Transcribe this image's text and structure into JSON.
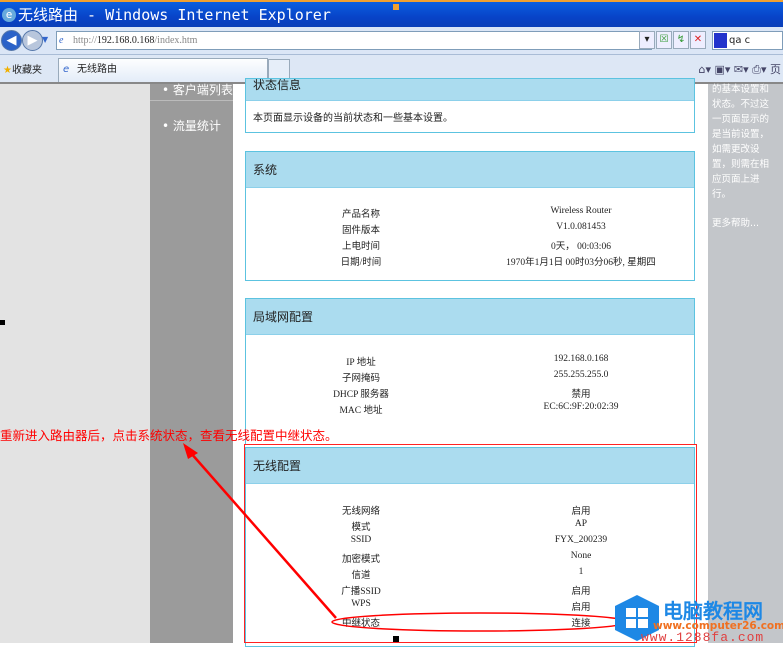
{
  "window": {
    "title": "无线路由 - Windows Internet Explorer"
  },
  "addressbar": {
    "url_prefix": "http://",
    "url_host": "192.168.0.168",
    "url_path": "/index.htm",
    "search_value": "qa c"
  },
  "tabbar": {
    "favorites": "收藏夹",
    "tab_title": "无线路由",
    "page_menu": "页"
  },
  "menu": {
    "items": [
      "客户端列表",
      "流量统计"
    ]
  },
  "help": {
    "text": "的基本设置和状态。不过这一页面显示的是当前设置，如需更改设置，则需在相应页面上进行。",
    "more": "更多帮助..."
  },
  "intro": {
    "header": "状态信息",
    "text": "本页面显示设备的当前状态和一些基本设置。"
  },
  "system": {
    "title": "系统",
    "rows": [
      [
        "产品名称",
        "Wireless Router"
      ],
      [
        "固件版本",
        "V1.0.081453"
      ],
      [
        "上电时间",
        "0天， 00:03:06"
      ],
      [
        "日期/时间",
        "1970年1月1日 00时03分06秒, 星期四"
      ]
    ]
  },
  "lan": {
    "title": "局域网配置",
    "rows": [
      [
        "IP 地址",
        "192.168.0.168"
      ],
      [
        "子网掩码",
        "255.255.255.0"
      ],
      [
        "DHCP 服务器",
        "禁用"
      ],
      [
        "MAC 地址",
        "EC:6C:9F:20:02:39"
      ]
    ]
  },
  "wireless": {
    "title": "无线配置",
    "rows": [
      [
        "无线网络",
        "启用"
      ],
      [
        "模式",
        "AP"
      ],
      [
        "SSID",
        "FYX_200239"
      ],
      [
        "加密模式",
        "None"
      ],
      [
        "信道",
        "1"
      ],
      [
        "广播SSID",
        "启用"
      ],
      [
        "WPS",
        "启用"
      ],
      [
        "中继状态",
        "连接"
      ]
    ]
  },
  "annotation": {
    "text": "重新进入路由器后，点击系统状态，查看无线配置中继状态。",
    "color": "#ff0000"
  },
  "watermark": {
    "name": "电脑教程网",
    "url1": "www.computer26.com",
    "url2": "www.1288fa.com"
  }
}
